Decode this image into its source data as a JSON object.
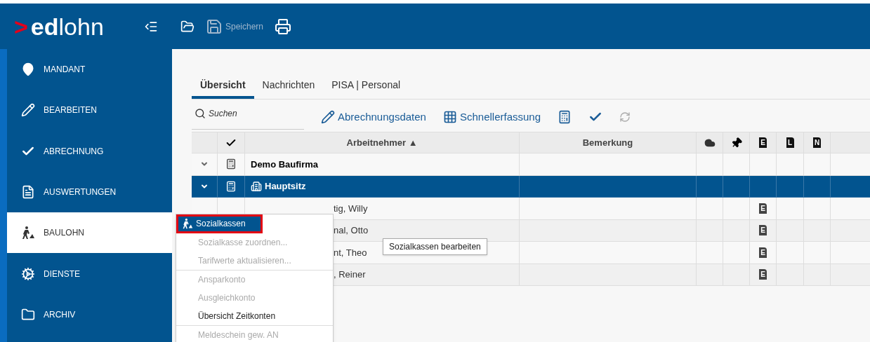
{
  "logo": {
    "mark": ">",
    "bold": "ed",
    "light": "lohn"
  },
  "toolbar_top": [
    {
      "kind": "collapse",
      "disabled": false
    },
    {
      "kind": "open",
      "disabled": false
    },
    {
      "kind": "save",
      "label": "Speichern",
      "disabled": true
    },
    {
      "kind": "print",
      "disabled": false
    }
  ],
  "sidebar": {
    "items": [
      {
        "kind": "pin",
        "label": "MANDANT",
        "selected": false
      },
      {
        "kind": "pencil",
        "label": "BEARBEITEN",
        "selected": false
      },
      {
        "kind": "check",
        "label": "ABRECHNUNG",
        "selected": false
      },
      {
        "kind": "doc",
        "label": "AUSWERTUNGEN",
        "selected": false
      },
      {
        "kind": "worker",
        "label": "BAULOHN",
        "selected": true
      },
      {
        "kind": "cogs",
        "label": "DIENSTE",
        "selected": false
      },
      {
        "kind": "folder",
        "label": "ARCHIV",
        "selected": false
      }
    ]
  },
  "tabs": [
    {
      "label": "Übersicht",
      "selected": true
    },
    {
      "label": "Nachrichten",
      "selected": false
    },
    {
      "label": "PISA | Personal",
      "selected": false
    }
  ],
  "search": {
    "placeholder": "Suchen"
  },
  "actions": [
    {
      "kind": "pencil",
      "label": "Abrechnungsdaten",
      "disabled": false
    },
    {
      "kind": "grid",
      "label": "Schnellerfassung",
      "disabled": false
    },
    {
      "kind": "calc",
      "disabled": false
    },
    {
      "kind": "check",
      "disabled": false
    },
    {
      "kind": "sync",
      "disabled": true
    }
  ],
  "table": {
    "columns": [
      {
        "kind": "blank"
      },
      {
        "kind": "check"
      },
      {
        "kind": "text",
        "label": "Arbeitnehmer ▲"
      },
      {
        "kind": "text",
        "label": "Bemerkung"
      },
      {
        "kind": "cloud"
      },
      {
        "kind": "pin"
      },
      {
        "kind": "letter",
        "label": "E"
      },
      {
        "kind": "letter",
        "label": "L"
      },
      {
        "kind": "letter",
        "label": "N"
      }
    ],
    "rows": [
      {
        "kind": "group",
        "name": "Demo Baufirma",
        "expanded": true,
        "selected": false
      },
      {
        "kind": "site",
        "name": "Hauptsitz",
        "expanded": true,
        "selected": true
      },
      {
        "kind": "person",
        "name": "tig, Willy",
        "e": "E",
        "selected": false
      },
      {
        "kind": "person",
        "name": "nal, Otto",
        "e": "E",
        "selected": false
      },
      {
        "kind": "person",
        "name": "nt, Theo",
        "e": "E",
        "selected": false
      },
      {
        "kind": "person",
        "name": ", Reiner",
        "e": "E",
        "selected": false
      }
    ]
  },
  "context_menu": {
    "items": [
      {
        "label": "Sozialkassen",
        "kind": "worker",
        "selected": true,
        "disabled": false,
        "divider_after": false
      },
      {
        "label": "Sozialkasse zuordnen...",
        "selected": false,
        "disabled": true,
        "divider_after": false
      },
      {
        "label": "Tarifwerte aktualisieren...",
        "selected": false,
        "disabled": true,
        "divider_after": true
      },
      {
        "label": "Ansparkonto",
        "selected": false,
        "disabled": true,
        "divider_after": false
      },
      {
        "label": "Ausgleichkonto",
        "selected": false,
        "disabled": true,
        "divider_after": false
      },
      {
        "label": "Übersicht Zeitkonten",
        "selected": false,
        "disabled": false,
        "divider_after": true
      },
      {
        "label": "Meldeschein gew. AN",
        "selected": false,
        "disabled": true,
        "divider_after": false
      }
    ]
  },
  "tooltip": "Sozialkassen bearbeiten"
}
